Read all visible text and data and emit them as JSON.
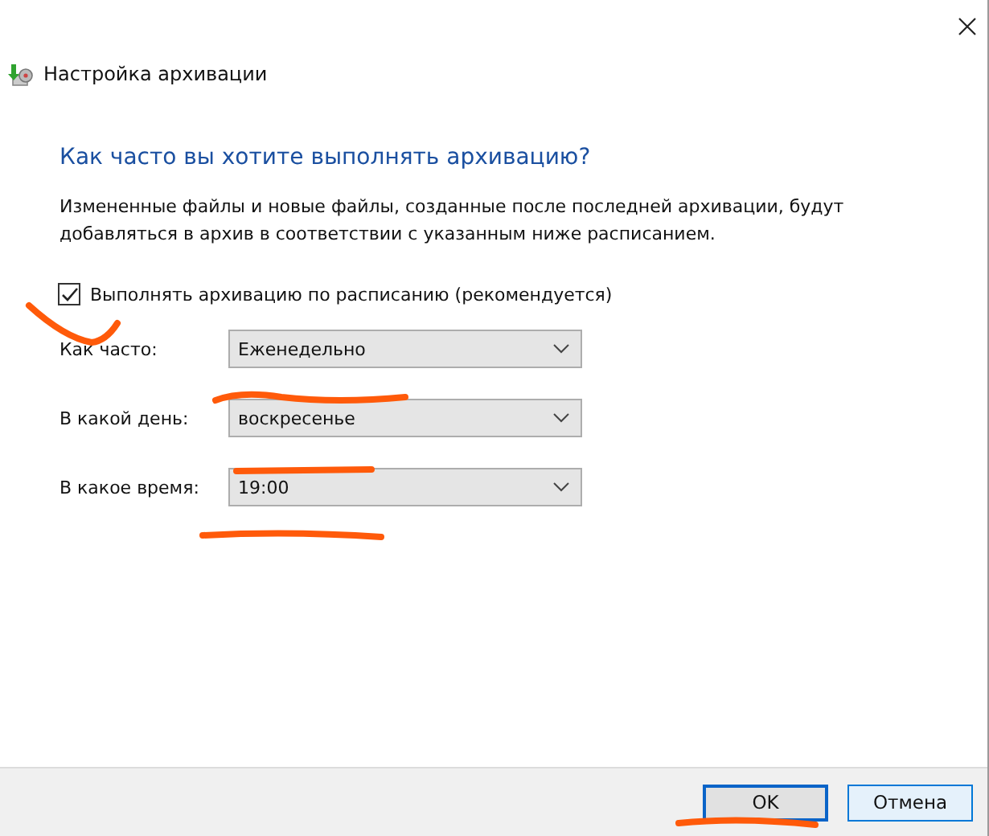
{
  "window": {
    "title": "Настройка архивации"
  },
  "heading": "Как часто вы хотите выполнять архивацию?",
  "description": "Измененные файлы и новые файлы, созданные после последней архивации, будут добавляться в архив в соответствии с указанным ниже расписанием.",
  "schedule_checkbox": {
    "label": "Выполнять архивацию по расписанию (рекомендуется)",
    "checked": true
  },
  "fields": [
    {
      "label": "Как часто:",
      "value": "Еженедельно"
    },
    {
      "label": "В какой день:",
      "value": "воскресенье"
    },
    {
      "label": "В какое время:",
      "value": "19:00"
    }
  ],
  "buttons": [
    {
      "label": "OK",
      "default": true
    },
    {
      "label": "Отмена",
      "default": false
    }
  ]
}
